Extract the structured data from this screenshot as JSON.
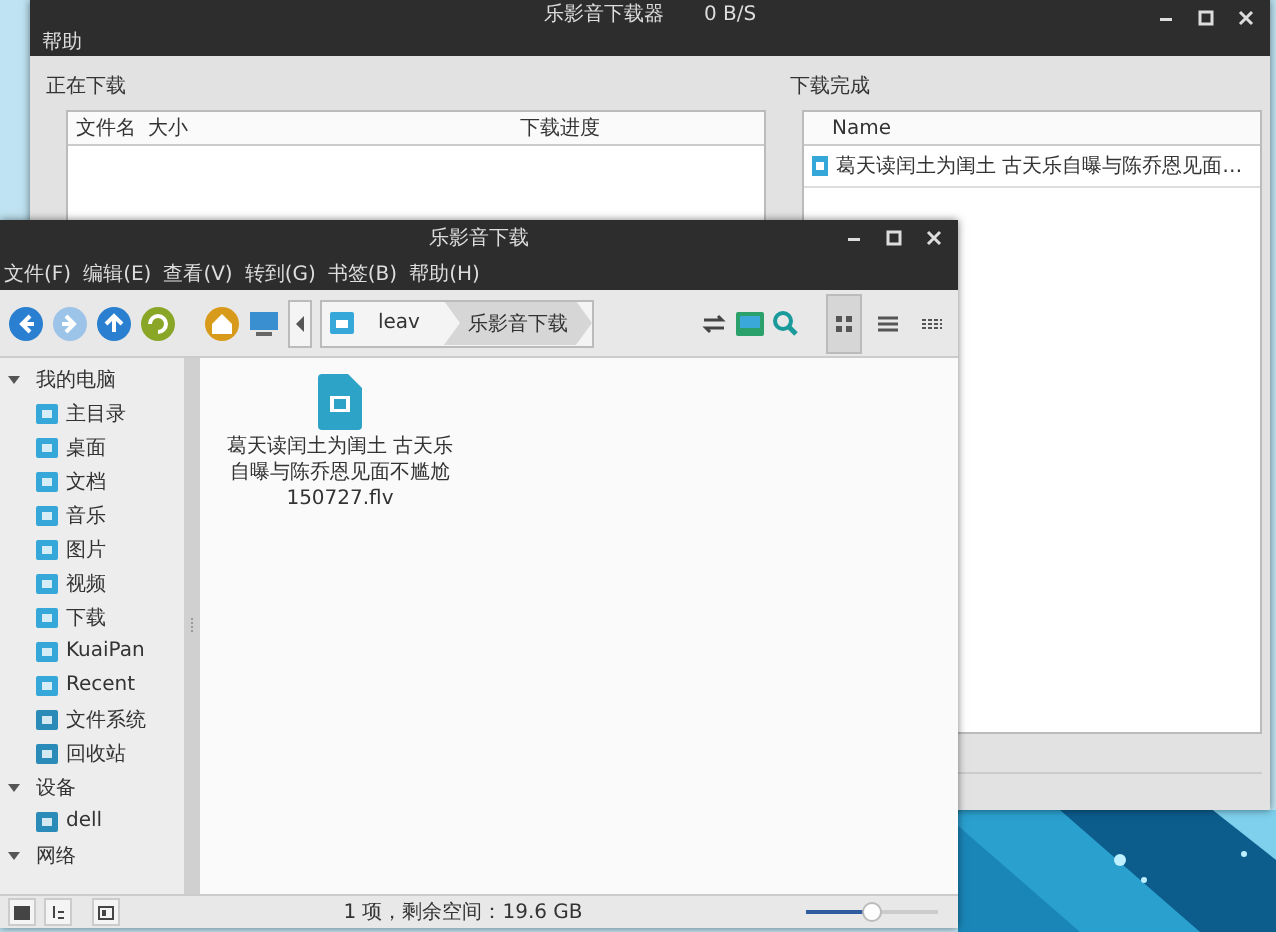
{
  "back_window": {
    "title": "乐影音下载器",
    "speed": "0 B/S",
    "menu": [
      "帮助"
    ],
    "downloading": {
      "label": "正在下载",
      "columns": [
        "文件名",
        "大小",
        "下载进度"
      ]
    },
    "completed": {
      "label": "下载完成",
      "column": "Name",
      "items": [
        {
          "name": "葛天读闰土为闺土 古天乐自曝与陈乔恩见面…"
        }
      ]
    }
  },
  "front_window": {
    "title": "乐影音下载",
    "menu": [
      "文件(F)",
      "编辑(E)",
      "查看(V)",
      "转到(G)",
      "书签(B)",
      "帮助(H)"
    ],
    "nav_buttons": [
      {
        "kind": "back",
        "disabled": false
      },
      {
        "kind": "forward",
        "disabled": true
      },
      {
        "kind": "up",
        "disabled": false
      },
      {
        "kind": "reload",
        "disabled": false
      }
    ],
    "path": [
      {
        "label": "leav",
        "selected": false
      },
      {
        "label": "乐影音下载",
        "selected": true
      }
    ],
    "views": [
      {
        "kind": "icons",
        "selected": true
      },
      {
        "kind": "list",
        "selected": false
      },
      {
        "kind": "compact",
        "selected": false
      }
    ],
    "sidebar": [
      {
        "label": "我的电脑",
        "expanded": true,
        "items": [
          {
            "label": "主目录",
            "kind": "home"
          },
          {
            "label": "桌面",
            "kind": "desktop"
          },
          {
            "label": "文档",
            "kind": "folder"
          },
          {
            "label": "音乐",
            "kind": "folder"
          },
          {
            "label": "图片",
            "kind": "folder"
          },
          {
            "label": "视频",
            "kind": "folder"
          },
          {
            "label": "下载",
            "kind": "folder"
          },
          {
            "label": "KuaiPan",
            "kind": "desktop"
          },
          {
            "label": "Recent",
            "kind": "desktop"
          },
          {
            "label": "文件系统",
            "kind": "drive"
          },
          {
            "label": "回收站",
            "kind": "trash"
          }
        ]
      },
      {
        "label": "设备",
        "expanded": true,
        "items": [
          {
            "label": "dell",
            "kind": "drive"
          }
        ]
      },
      {
        "label": "网络",
        "expanded": true
      }
    ],
    "files": [
      {
        "name_lines": [
          "葛天读闰土为闺土 古天乐",
          "自曝与陈乔恩见面不尴尬",
          "150727.flv"
        ]
      }
    ],
    "status": "1 项，剩余空间：19.6 GB",
    "zoom": {
      "level": 0.5
    }
  }
}
